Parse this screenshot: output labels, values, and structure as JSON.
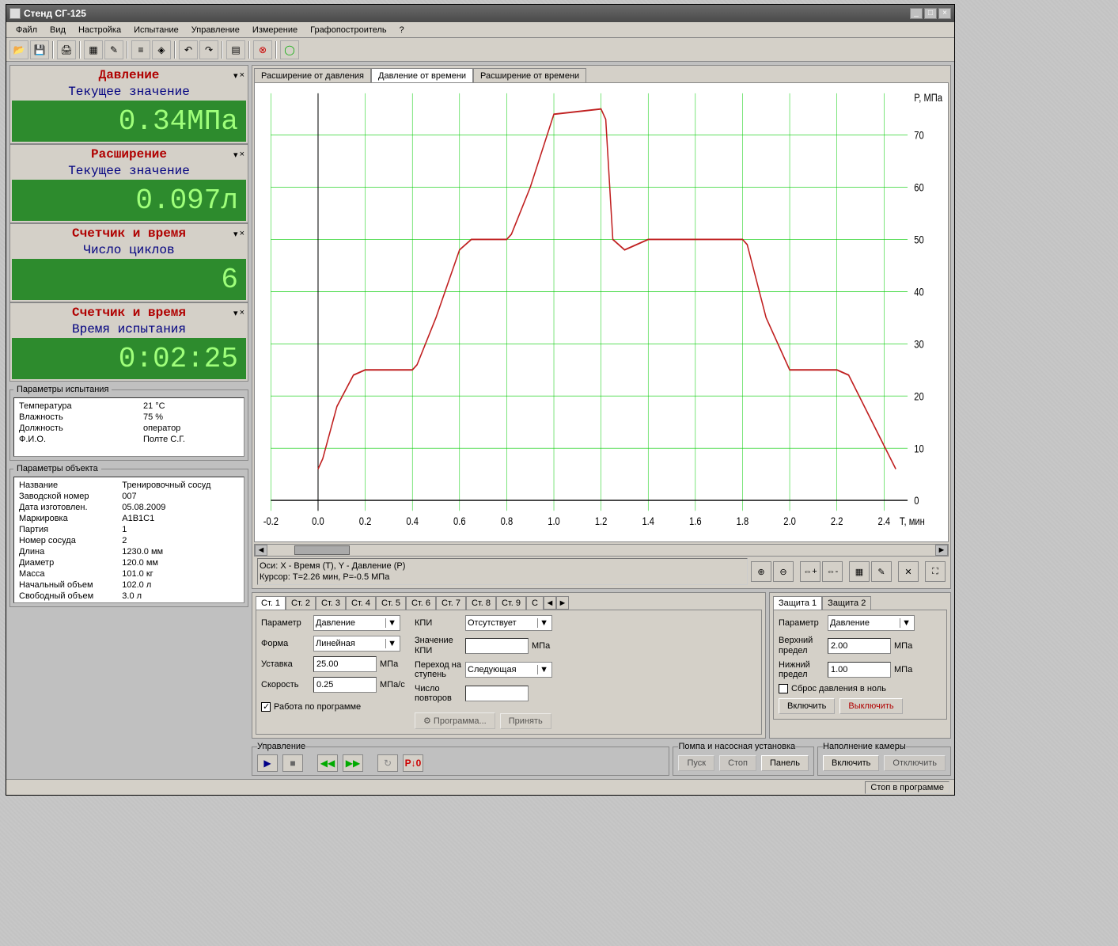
{
  "window_title": "Стенд СГ-125",
  "menu": [
    "Файл",
    "Вид",
    "Настройка",
    "Испытание",
    "Управление",
    "Измерение",
    "Графопостроитель",
    "?"
  ],
  "gauges": [
    {
      "title": "Давление",
      "sub": "Текущее значение",
      "value": "0.34МПа"
    },
    {
      "title": "Расширение",
      "sub": "Текущее значение",
      "value": "0.097л"
    },
    {
      "title": "Счетчик и время",
      "sub": "Число циклов",
      "value": "6"
    },
    {
      "title": "Счетчик и время",
      "sub": "Время испытания",
      "value": "0:02:25"
    }
  ],
  "test_params_title": "Параметры испытания",
  "test_params": [
    [
      "Температура",
      "21 °С"
    ],
    [
      "Влажность",
      "75 %"
    ],
    [
      "Должность",
      "оператор"
    ],
    [
      "Ф.И.О.",
      "Полте С.Г."
    ]
  ],
  "obj_params_title": "Параметры объекта",
  "obj_params": [
    [
      "Название",
      "Тренировочный сосуд"
    ],
    [
      "Заводской номер",
      "007"
    ],
    [
      "Дата изготовлен.",
      "05.08.2009"
    ],
    [
      "Маркировка",
      "А1В1С1"
    ],
    [
      "Партия",
      "1"
    ],
    [
      "Номер сосуда",
      "2"
    ],
    [
      "Длина",
      "1230.0 мм"
    ],
    [
      "Диаметр",
      "120.0 мм"
    ],
    [
      "Масса",
      "101.0 кг"
    ],
    [
      "Начальный объем",
      "102.0 л"
    ],
    [
      "Свободный объем",
      "3.0 л"
    ]
  ],
  "chart_tabs": [
    "Расширение от давления",
    "Давление от времени",
    "Расширение от времени"
  ],
  "chart_active_tab": 1,
  "chart_axes_info": "Оси: X - Время (T), Y - Давление (P)",
  "chart_cursor_info": "Курсор: T=2.26 мин, P=-0.5 МПа",
  "chart_ylabel": "P, МПа",
  "chart_xlabel": "T, мин",
  "chart_data": {
    "type": "line",
    "xlabel": "T, мин",
    "ylabel": "P, МПа",
    "xlim": [
      -0.2,
      2.5
    ],
    "ylim": [
      -2,
      78
    ],
    "xticks": [
      -0.2,
      -0.0,
      0.2,
      0.4,
      0.6,
      0.8,
      1.0,
      1.2,
      1.4,
      1.6,
      1.8,
      2.0,
      2.2,
      2.4
    ],
    "yticks": [
      0,
      10,
      20,
      30,
      40,
      50,
      60,
      70
    ],
    "series": [
      {
        "name": "Давление",
        "color": "#c02020",
        "x": [
          0.0,
          0.02,
          0.08,
          0.15,
          0.2,
          0.4,
          0.42,
          0.5,
          0.6,
          0.65,
          0.8,
          0.82,
          0.9,
          1.0,
          1.2,
          1.22,
          1.25,
          1.3,
          1.4,
          1.42,
          1.6,
          1.8,
          1.82,
          1.9,
          2.0,
          2.2,
          2.25,
          2.35,
          2.45
        ],
        "y": [
          6,
          8,
          18,
          24,
          25,
          25,
          26,
          35,
          48,
          50,
          50,
          51,
          60,
          74,
          75,
          73,
          50,
          48,
          50,
          50,
          50,
          50,
          49,
          35,
          25,
          25,
          24,
          15,
          6
        ]
      }
    ]
  },
  "step_tabs": [
    "Ст. 1",
    "Ст. 2",
    "Ст. 3",
    "Ст. 4",
    "Ст. 5",
    "Ст. 6",
    "Ст. 7",
    "Ст. 8",
    "Ст. 9",
    "С"
  ],
  "step": {
    "param_label": "Параметр",
    "param": "Давление",
    "form_label": "Форма",
    "form": "Линейная",
    "set_label": "Уставка",
    "set_val": "25.00",
    "set_unit": "МПа",
    "speed_label": "Скорость",
    "speed_val": "0.25",
    "speed_unit": "МПа/с",
    "kpi_label": "КПИ",
    "kpi": "Отсутствует",
    "kpi_val_label": "Значение КПИ",
    "kpi_unit": "МПа",
    "go_label": "Переход на ступень",
    "go": "Следующая",
    "rep_label": "Число повторов",
    "prog_cb": "Работа по программе",
    "btn_prog": "Программа...",
    "btn_accept": "Принять"
  },
  "prot_tabs": [
    "Защита 1",
    "Защита 2"
  ],
  "prot": {
    "param_label": "Параметр",
    "param": "Давление",
    "upper_label": "Верхний предел",
    "upper": "2.00",
    "unit": "МПа",
    "lower_label": "Нижний предел",
    "lower": "1.00",
    "reset_cb": "Сброс давления в ноль",
    "on": "Включить",
    "off": "Выключить"
  },
  "ctrl": {
    "control_label": "Управление",
    "pump_label": "Помпа и насосная установка",
    "pump_start": "Пуск",
    "pump_stop": "Стоп",
    "pump_panel": "Панель",
    "fill_label": "Наполнение камеры",
    "fill_on": "Включить",
    "fill_off": "Отключить"
  },
  "status": "Стоп в программе"
}
